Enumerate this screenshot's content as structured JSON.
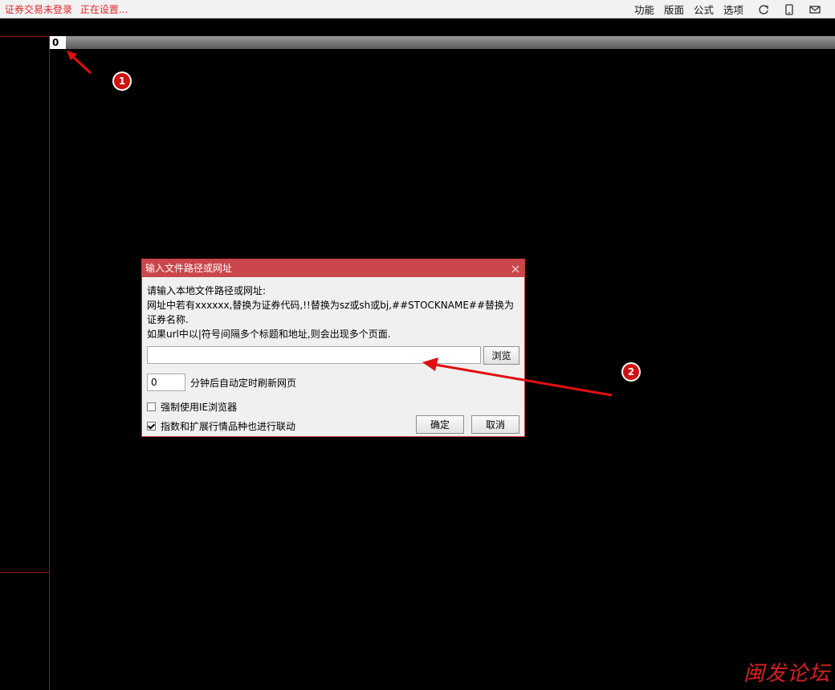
{
  "topbar": {
    "status": [
      "证券交易未登录",
      "正在设置..."
    ],
    "menu": [
      "功能",
      "版面",
      "公式",
      "选项"
    ],
    "icons": [
      "refresh-icon",
      "phone-icon",
      "mail-icon"
    ]
  },
  "tabs": {
    "first_label": "0"
  },
  "annotations": {
    "badge1": "1",
    "badge2": "2"
  },
  "dialog": {
    "title": "输入文件路径或网址",
    "desc_line1": "请输入本地文件路径或网址:",
    "desc_line2": "网址中若有xxxxxx,替换为证券代码,!!替换为sz或sh或bj,##STOCKNAME##替换为证券名称.",
    "desc_line3": "如果url中以|符号间隔多个标题和地址,则会出现多个页面.",
    "path_value": "",
    "browse_label": "浏览",
    "minutes_value": "0",
    "minutes_label": "分钟后自动定时刷新网页",
    "force_ie_label": "强制使用IE浏览器",
    "force_ie_checked": false,
    "link_label": "指数和扩展行情品种也进行联动",
    "link_checked": true,
    "ok_label": "确定",
    "cancel_label": "取消"
  },
  "watermark": "闽发论坛",
  "colors": {
    "accent": "#c9464a",
    "status_red": "#e3262a",
    "background": "#000000"
  }
}
